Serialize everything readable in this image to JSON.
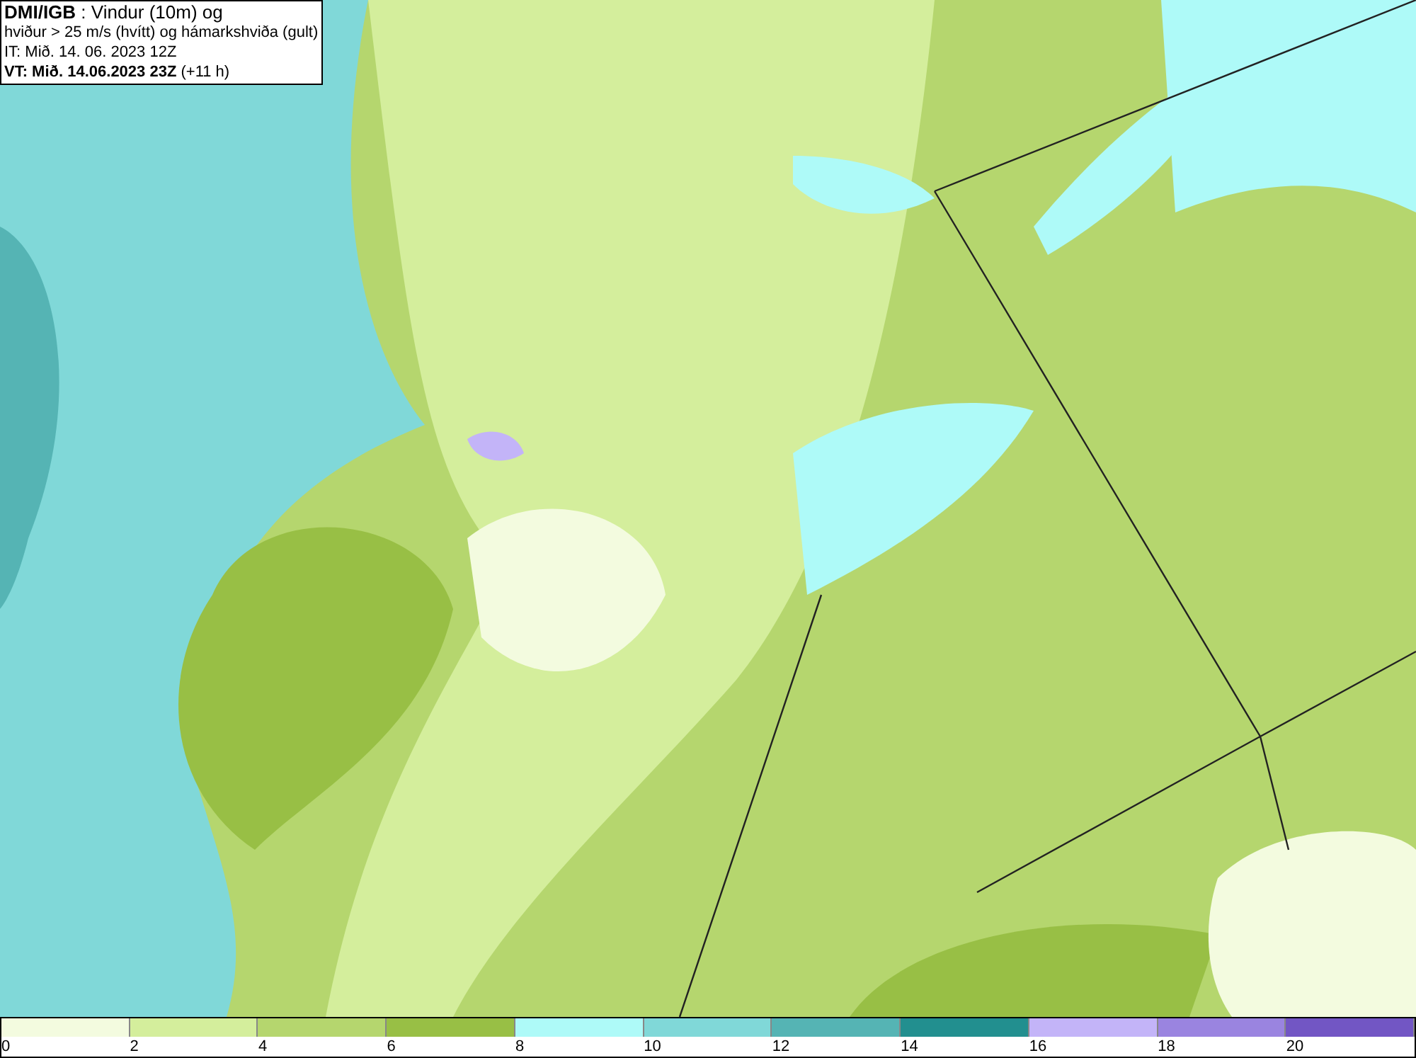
{
  "header": {
    "lines": [
      "**DMI/IGB** : Vindur (10m) og",
      "hviður > 25 m/s (hvítt) og hámarkshviða (gult)",
      "IT: Mið. 14. 06. 2023 12Z",
      "**VT: Mið. 14.06.2023 23Z** (+11 h)"
    ]
  },
  "legend": {
    "bins": [
      {
        "label": "0",
        "color": "#f3fbdf"
      },
      {
        "label": "2",
        "color": "#d4ee9c"
      },
      {
        "label": "4",
        "color": "#b5d66e"
      },
      {
        "label": "6",
        "color": "#98bf45"
      },
      {
        "label": "8",
        "color": "#aefaf8"
      },
      {
        "label": "10",
        "color": "#80d8d8"
      },
      {
        "label": "12",
        "color": "#55b4b4"
      },
      {
        "label": "14",
        "color": "#228f8f"
      },
      {
        "label": "16",
        "color": "#c3b4f8"
      },
      {
        "label": "18",
        "color": "#9a84e0"
      },
      {
        "label": "20",
        "color": "#7256c4"
      }
    ]
  }
}
